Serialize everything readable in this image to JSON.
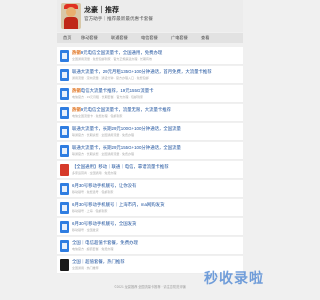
{
  "header": {
    "site_name": "龙豪｜推荐",
    "site_sub": "官方助手｜推荐最新最优惠卡套餐"
  },
  "nav": [
    {
      "label": "首页"
    },
    {
      "label": "移动套餐"
    },
    {
      "label": "联通套餐"
    },
    {
      "label": "电信套餐"
    },
    {
      "label": "广电套餐"
    },
    {
      "label": "查看"
    }
  ],
  "items": [
    {
      "tag": "热销",
      "title": "9元电信全国流量卡，全国通用，免费办理",
      "desc": "全国通用流量 · 免费包邮到家 · 官方正规渠道办理 · 长期有效",
      "thumb": "blue"
    },
    {
      "tag": "",
      "title": "联通大流量卡，29元月租135G+100分钟通话，首月免费，大流量卡推荐",
      "desc": "通用流量 · 定向流量 · 通话分钟 · 官方办理入口 · 免费包邮",
      "thumb": "blue"
    },
    {
      "tag": "热销",
      "title": "电信大流量卡推荐，19元155G流量卡",
      "desc": "电信官方 · 19元月租 · 长期套餐 · 官方办理 · 包邮到家",
      "thumb": "blue"
    },
    {
      "tag": "热销",
      "title": "9元电信全国流量卡，流量无限，大流量卡推荐",
      "desc": "电信全国流量卡 · 免费办理 · 包邮到家",
      "thumb": "blue"
    },
    {
      "tag": "",
      "title": "联通大流量卡，长期29元100G+100分钟通话，全国流量",
      "desc": "联通官方 · 长期资费 · 全国通用流量 · 免费办理",
      "thumb": "blue"
    },
    {
      "tag": "",
      "title": "联通大流量卡，长期29元155G+100分钟通话，全国流量",
      "desc": "联通官方 · 长期资费 · 全国通用流量 · 免费办理",
      "thumb": "blue"
    },
    {
      "tag": "",
      "title": "【全国通用】移动｜联通｜电信，靠谱流量卡推荐",
      "desc": "多家运营商 · 全国通用 · 免费办理",
      "thumb": "red"
    },
    {
      "tag": "",
      "title": "6月30号移动手机靓号，让你没有",
      "desc": "移动靓号 · 免费选号 · 包邮到家",
      "thumb": "blue"
    },
    {
      "tag": "",
      "title": "6月30号移动手机靓号｜上海市内，ma网购发货",
      "desc": "移动靓号 · 上海 · 包邮到家",
      "thumb": "blue"
    },
    {
      "tag": "",
      "title": "6月30号移动手机靓号，全国发货",
      "desc": "移动靓号 · 全国发货",
      "thumb": "blue"
    },
    {
      "tag": "",
      "title": "全国｜电信超值卡套餐，免费办理",
      "desc": "电信官方 · 超值套餐 · 免费办理",
      "thumb": "blue"
    },
    {
      "tag": "",
      "title": "全国｜超值套餐，热门推荐",
      "desc": "全国通用 · 热门推荐",
      "thumb": "dark"
    }
  ],
  "footer": "©2021 龙豪推荐 全国流量卡推荐 · 请注意防范诈骗",
  "watermark": "秒收录啦"
}
